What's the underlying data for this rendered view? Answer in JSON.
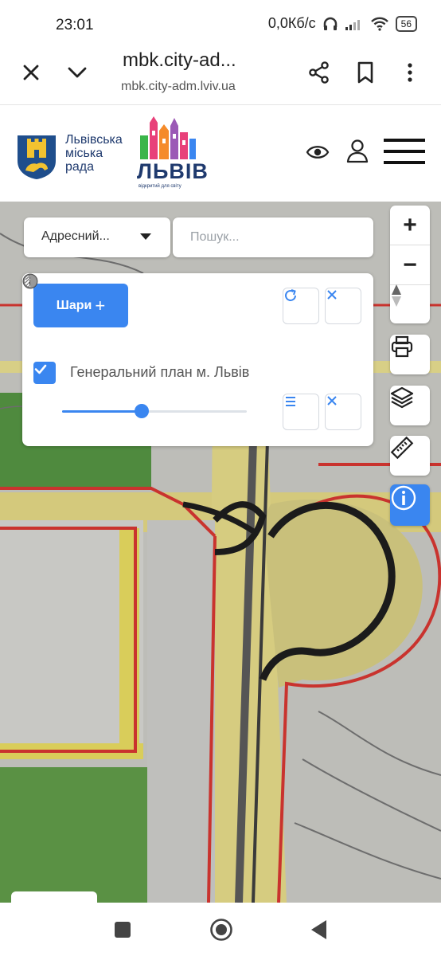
{
  "status_bar": {
    "time": "23:01",
    "network_speed": "0,0Кб/с",
    "battery": "56"
  },
  "browser": {
    "title": "mbk.city-ad...",
    "url": "mbk.city-adm.lviv.ua",
    "icons": [
      "close-icon",
      "chevron-down-icon",
      "share-icon",
      "bookmark-icon",
      "more-vertical-icon"
    ]
  },
  "header": {
    "logo_line1": "Львівська",
    "logo_line2": "міська",
    "logo_line3": "рада",
    "brand_name": "ЛЬВІВ",
    "brand_tagline": "відкритий для світу",
    "icons": [
      "eye-icon",
      "user-icon",
      "menu-icon"
    ]
  },
  "map_controls": {
    "address_type": "Адресний...",
    "search_placeholder": "Пошук...",
    "zoom_in": "+",
    "zoom_out": "−",
    "tool_icons": [
      "printer-icon",
      "layers-icon",
      "ruler-icon",
      "info-icon"
    ]
  },
  "layers_panel": {
    "add_layers_label": "Шари",
    "add_layers_plus": "+",
    "layer_name": "Генеральний план м. Львів",
    "layer_checked": true,
    "opacity_percent": 43,
    "accent_color": "#3a86f0"
  }
}
